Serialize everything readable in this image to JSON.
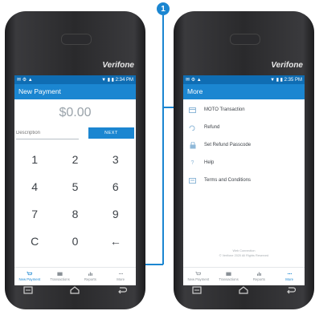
{
  "callout": {
    "number": "1"
  },
  "brand": "Verifone",
  "left_screen": {
    "status_time": "2:34 PM",
    "title": "New Payment",
    "amount": "$0.00",
    "description_placeholder": "Description",
    "next_label": "NEXT",
    "keys": [
      "1",
      "2",
      "3",
      "4",
      "5",
      "6",
      "7",
      "8",
      "9",
      "C",
      "0",
      "←"
    ],
    "tabs": [
      {
        "label": "New Payment",
        "icon": "cart-icon",
        "active": true
      },
      {
        "label": "Transactions",
        "icon": "folder-icon",
        "active": false
      },
      {
        "label": "Reports",
        "icon": "bar-chart-icon",
        "active": false
      },
      {
        "label": "More",
        "icon": "more-dots-icon",
        "active": false
      }
    ]
  },
  "right_screen": {
    "status_time": "2:35 PM",
    "title": "More",
    "menu": [
      {
        "label": "MOTO Transaction",
        "icon": "card-icon"
      },
      {
        "label": "Refund",
        "icon": "refund-icon"
      },
      {
        "label": "Set Refund Passcode",
        "icon": "lock-icon"
      },
      {
        "label": "Help",
        "icon": "help-icon"
      },
      {
        "label": "Terms and Conditions",
        "icon": "document-icon"
      }
    ],
    "footer_line1": "Web Connection",
    "footer_line2": "© Verifone 2020 All Rights Reserved",
    "tabs": [
      {
        "label": "New Payment",
        "icon": "cart-icon",
        "active": false
      },
      {
        "label": "Transactions",
        "icon": "folder-icon",
        "active": false
      },
      {
        "label": "Reports",
        "icon": "bar-chart-icon",
        "active": false
      },
      {
        "label": "More",
        "icon": "more-dots-icon",
        "active": true
      }
    ]
  },
  "colors": {
    "accent": "#1b86d1",
    "status_bar": "#0f6db3",
    "device_body": "#2a2a2c"
  }
}
